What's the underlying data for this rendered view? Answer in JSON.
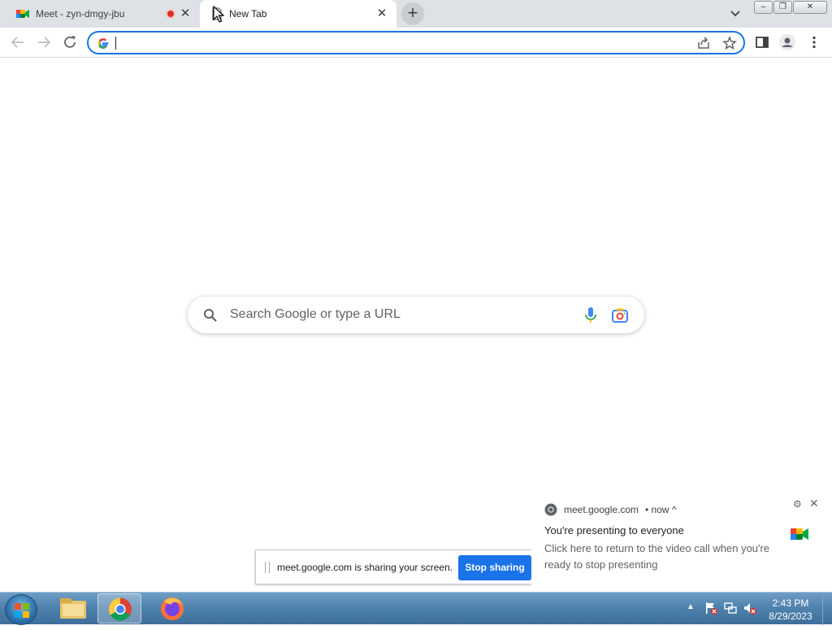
{
  "browser": {
    "tabs": [
      {
        "title": "Meet - zyn-dmgy-jbu",
        "recording": true,
        "active": false
      },
      {
        "title": "New Tab",
        "active": true
      }
    ],
    "new_tab_symbol": "+",
    "tab_close_symbol": "✕",
    "window_controls": {
      "minimize": "–",
      "maximize": "❐",
      "close": "✕"
    },
    "omnibox": {
      "value": "",
      "placeholder": ""
    }
  },
  "ntp": {
    "search_placeholder": "Search Google or type a URL"
  },
  "share_bar": {
    "message": "meet.google.com is sharing your screen.",
    "stop_label": "Stop sharing"
  },
  "notification": {
    "source": "meet.google.com",
    "time": "• now ^",
    "title": "You're presenting to everyone",
    "body": "Click here to return to the video call when you're ready to stop presenting",
    "gear_symbol": "⚙",
    "close_symbol": "✕"
  },
  "taskbar": {
    "time": "2:43 PM",
    "date": "8/29/2023",
    "tray_arrow": "▲"
  },
  "colors": {
    "accent": "#1a73e8",
    "tabstrip": "#dee1e6",
    "record_red": "#d93025"
  }
}
